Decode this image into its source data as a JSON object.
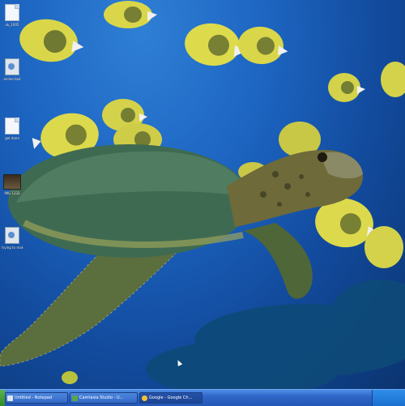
{
  "desktop": {
    "icons": [
      {
        "icon": "document-icon",
        "label": "ok_1005"
      },
      {
        "icon": "program-icon",
        "label": "online tool"
      },
      {
        "icon": "document-icon",
        "label": "get done"
      },
      {
        "icon": "photo-icon",
        "label": "IMG 1232"
      },
      {
        "icon": "program-icon",
        "label": "trying to make c..."
      }
    ]
  },
  "taskbar": {
    "tasks": [
      {
        "label": "Untitled - Notepad",
        "icon_color": "#dfe6ee",
        "active": false
      },
      {
        "label": "Camtasia Studio - U...",
        "icon_color": "#5aa54a",
        "active": false
      },
      {
        "label": "Google - Google Ch...",
        "icon_color": "#f2c23a",
        "active": true
      }
    ]
  },
  "colors": {
    "water_top": "#2f7fd6",
    "water_deep": "#0b3470",
    "taskbar_blue": "#2457b6",
    "tray_blue": "#1b6fd0",
    "start_green": "#2f8a2c",
    "fish_yellow": "#e3e04a",
    "turtle_shell": "#3f6a52"
  }
}
